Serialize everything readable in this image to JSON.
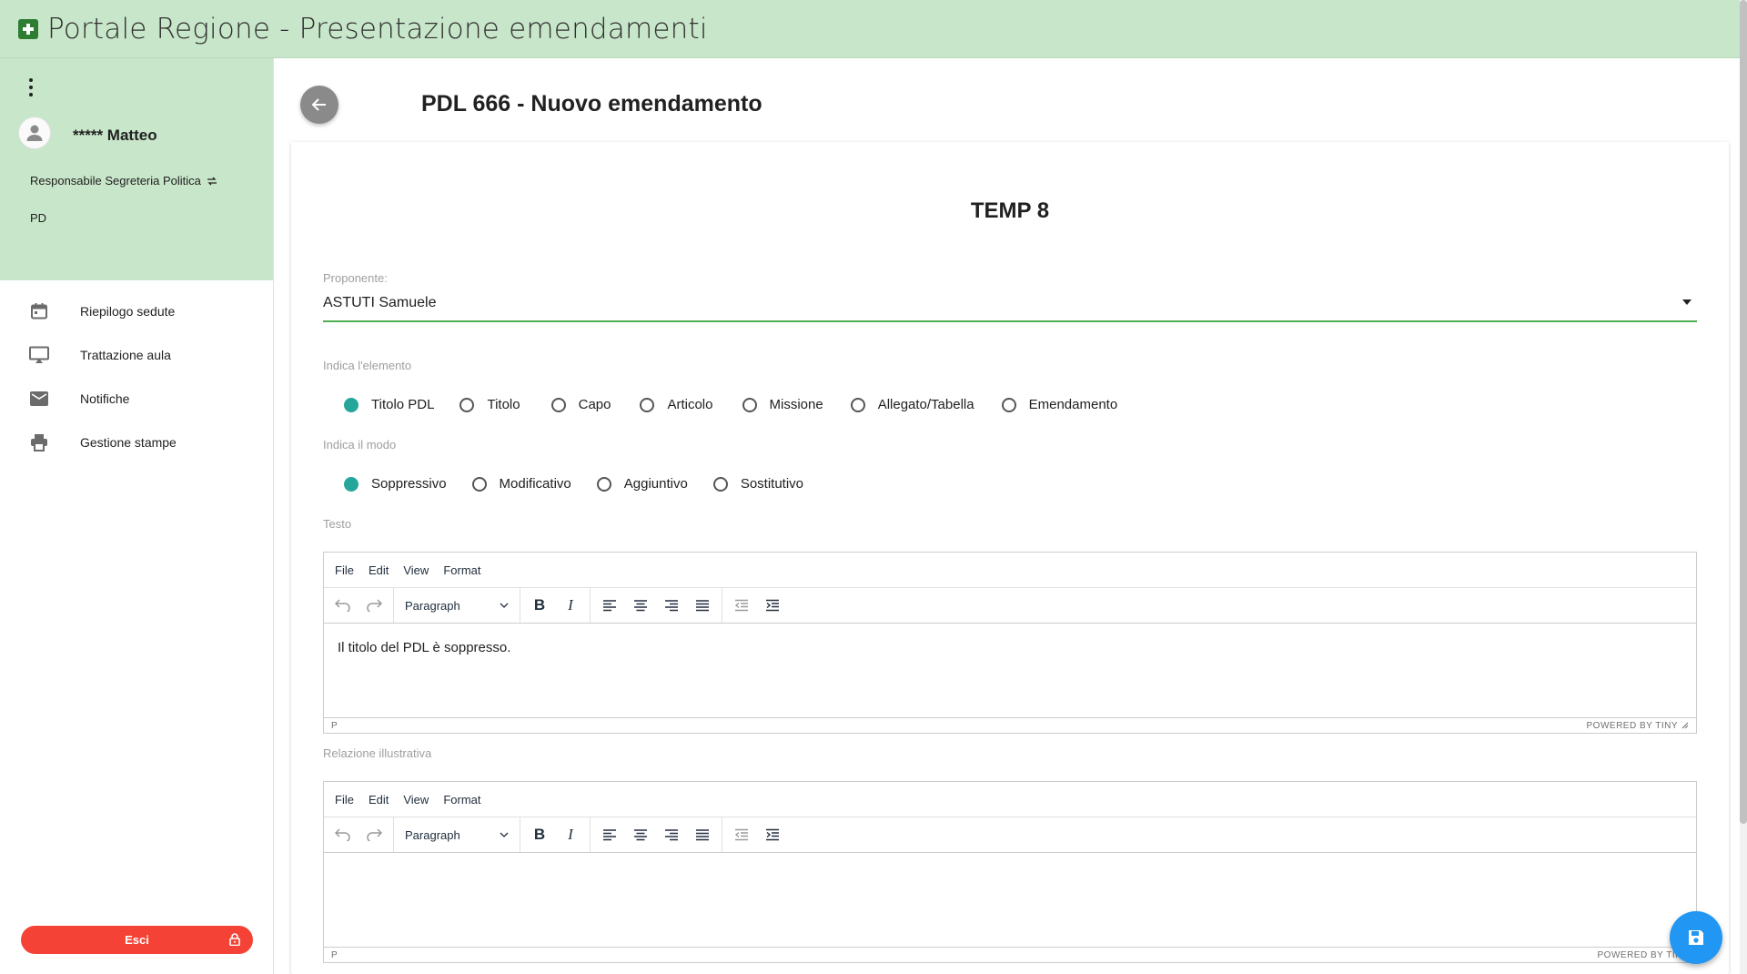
{
  "app": {
    "title": "Portale Regione - Presentazione emendamenti"
  },
  "user": {
    "name": "***** Matteo",
    "role": "Responsabile Segreteria Politica",
    "party": "PD"
  },
  "nav": {
    "items": [
      {
        "label": "Riepilogo sedute",
        "icon": "calendar-icon"
      },
      {
        "label": "Trattazione aula",
        "icon": "airplay-icon"
      },
      {
        "label": "Notifiche",
        "icon": "mail-icon"
      },
      {
        "label": "Gestione stampe",
        "icon": "printer-icon"
      }
    ]
  },
  "logout": {
    "label": "Esci"
  },
  "page": {
    "title": "PDL 666 - Nuovo emendamento"
  },
  "form": {
    "heading": "TEMP 8",
    "proponente": {
      "label": "Proponente:",
      "value": "ASTUTI Samuele"
    },
    "elemento": {
      "label": "Indica l'elemento",
      "options": [
        "Titolo PDL",
        "Titolo",
        "Capo",
        "Articolo",
        "Missione",
        "Allegato/Tabella",
        "Emendamento"
      ],
      "selected": "Titolo PDL"
    },
    "modo": {
      "label": "Indica il modo",
      "options": [
        "Soppressivo",
        "Modificativo",
        "Aggiuntivo",
        "Sostitutivo"
      ],
      "selected": "Soppressivo"
    },
    "testo": {
      "label": "Testo",
      "content": "Il titolo del PDL è soppresso.",
      "status_path": "P"
    },
    "relazione": {
      "label": "Relazione illustrativa",
      "content": "",
      "status_path": "P"
    }
  },
  "editor": {
    "menu": [
      "File",
      "Edit",
      "View",
      "Format"
    ],
    "block_format": "Paragraph",
    "powered_by": "POWERED BY TINY"
  },
  "colors": {
    "topbar": "#c8e6c9",
    "accent": "#26a69a",
    "logout": "#f44336",
    "fab": "#2196f3"
  }
}
